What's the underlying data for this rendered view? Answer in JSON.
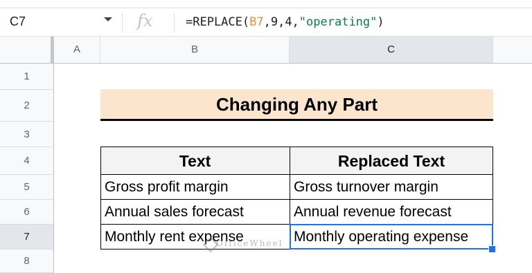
{
  "formula_bar": {
    "name_box": "C7",
    "fx_label": "fx",
    "formula_prefix": "=REPLACE(",
    "formula_ref": "B7",
    "formula_mid": ",9,4,",
    "formula_str": "\"operating\"",
    "formula_suffix": ")"
  },
  "columns": [
    "A",
    "B",
    "C"
  ],
  "rows": [
    "1",
    "2",
    "3",
    "4",
    "5",
    "6",
    "7",
    "8"
  ],
  "sheet": {
    "title": "Changing Any Part",
    "headers": {
      "text": "Text",
      "replaced": "Replaced Text"
    },
    "data": [
      {
        "text": "Gross profit margin",
        "replaced": "Gross turnover margin"
      },
      {
        "text": "Annual sales forecast",
        "replaced": "Annual revenue forecast"
      },
      {
        "text": "Monthly rent expense",
        "replaced": "Monthly operating expense"
      }
    ]
  },
  "watermark": "OfficeWheel",
  "colors": {
    "title_bg": "#fce5cd",
    "header_bg": "#f3f3f3",
    "selection": "#1a73e8"
  }
}
